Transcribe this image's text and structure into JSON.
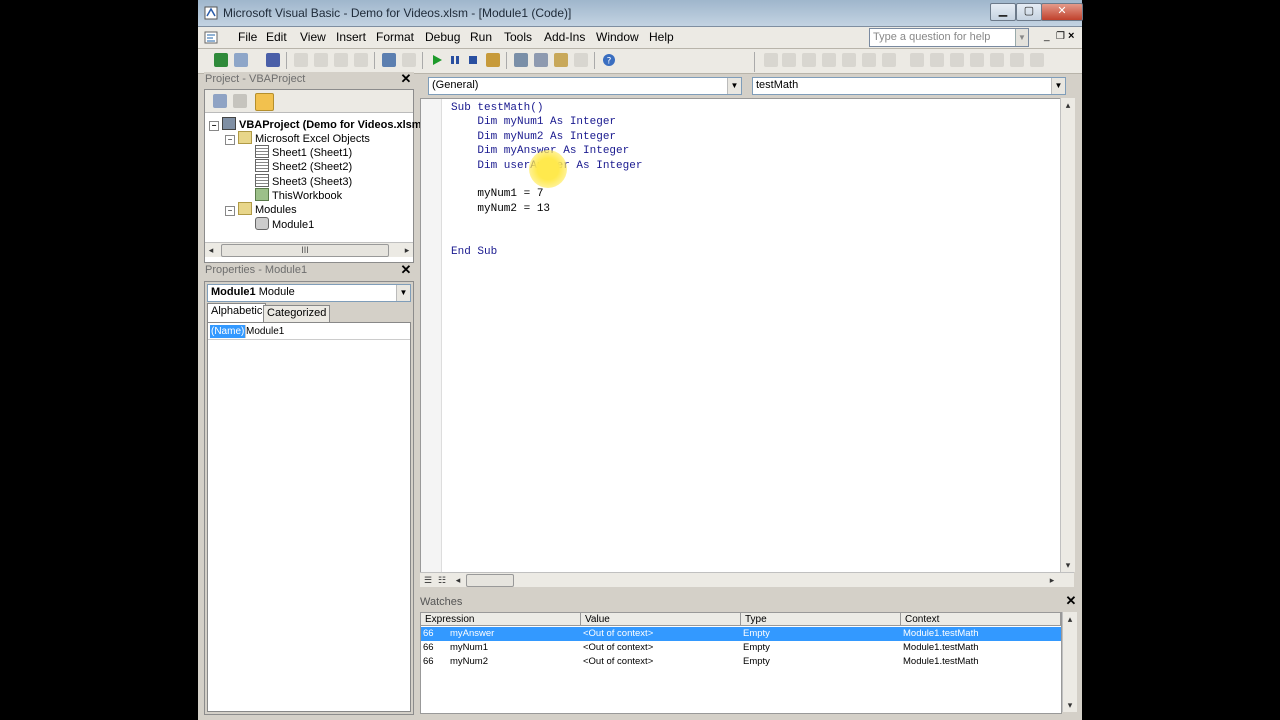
{
  "window": {
    "title": "Microsoft Visual Basic - Demo for Videos.xlsm - [Module1 (Code)]"
  },
  "menus": [
    "File",
    "Edit",
    "View",
    "Insert",
    "Format",
    "Debug",
    "Run",
    "Tools",
    "Add-Ins",
    "Window",
    "Help"
  ],
  "help_search": {
    "placeholder": "Type a question for help"
  },
  "project": {
    "title": "Project - VBAProject",
    "tree": [
      {
        "label": "VBAProject (Demo for Videos.xlsm",
        "icon": "project-icon"
      },
      {
        "label": "Microsoft Excel Objects",
        "icon": "folder-icon"
      },
      {
        "label": "Sheet1 (Sheet1)",
        "icon": "sheet-icon"
      },
      {
        "label": "Sheet2 (Sheet2)",
        "icon": "sheet-icon"
      },
      {
        "label": "Sheet3 (Sheet3)",
        "icon": "sheet-icon"
      },
      {
        "label": "ThisWorkbook",
        "icon": "workbook-icon"
      },
      {
        "label": "Modules",
        "icon": "folder-icon"
      },
      {
        "label": "Module1",
        "icon": "module-icon"
      }
    ]
  },
  "properties": {
    "title": "Properties - Module1",
    "object_bold": "Module1",
    "object_type": "Module",
    "tabs": [
      "Alphabetic",
      "Categorized"
    ],
    "rows": [
      {
        "name": "(Name)",
        "value": "Module1"
      }
    ]
  },
  "code": {
    "object_combo": "(General)",
    "proc_combo": "testMath",
    "lines": [
      "Sub testMath()",
      "    Dim myNum1 As Integer",
      "    Dim myNum2 As Integer",
      "    Dim myAnswer As Integer",
      "    Dim userAnswer As Integer",
      "",
      "    myNum1 = 7",
      "    myNum2 = 13",
      "",
      "",
      "End Sub"
    ]
  },
  "watches": {
    "title": "Watches",
    "columns": [
      "Expression",
      "Value",
      "Type",
      "Context"
    ],
    "rows": [
      {
        "expression": "myAnswer",
        "value": "<Out of context>",
        "type": "Empty",
        "context": "Module1.testMath",
        "selected": true
      },
      {
        "expression": "myNum1",
        "value": "<Out of context>",
        "type": "Empty",
        "context": "Module1.testMath",
        "selected": false
      },
      {
        "expression": "myNum2",
        "value": "<Out of context>",
        "type": "Empty",
        "context": "Module1.testMath",
        "selected": false
      }
    ]
  }
}
